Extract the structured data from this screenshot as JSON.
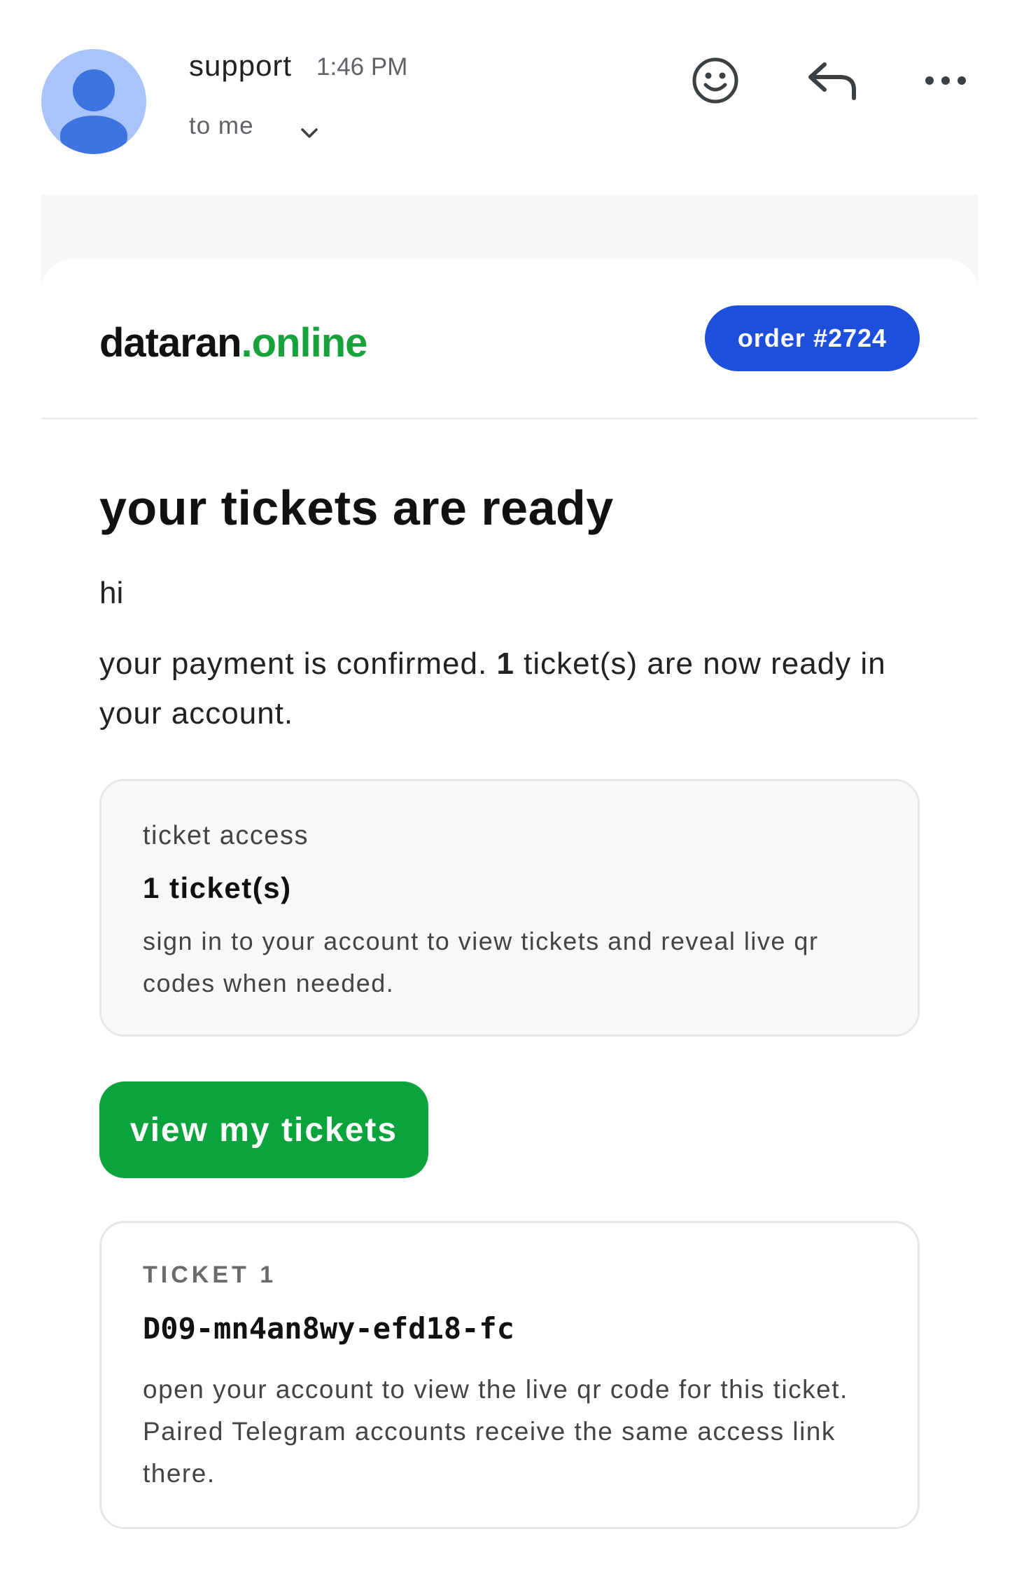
{
  "email_header": {
    "sender": "support",
    "time": "1:46 PM",
    "recipient": "to me",
    "icons": [
      "avatar-icon",
      "chevron-down-icon",
      "emoji-icon",
      "reply-icon",
      "more-icon"
    ]
  },
  "email_body": {
    "brand": {
      "name_main": "dataran",
      "name_accent": ".online",
      "accent_color": "#17a23c"
    },
    "order_badge": {
      "label": "order #2724",
      "color": "#1d4fdb"
    },
    "headline": "your tickets are ready",
    "greeting": "hi",
    "message": {
      "before": "your payment is confirmed. ",
      "count": "1",
      "after": " ticket(s) are now ready in your account."
    },
    "ticket_access": {
      "label": "ticket access",
      "count": "1 ticket(s)",
      "description": "sign in to your account to view tickets and reveal live qr codes when needed."
    },
    "view_button": {
      "label": "view my tickets",
      "color": "#0aa33c"
    },
    "ticket": {
      "label": "TICKET 1",
      "code": "D09-mn4an8wy-efd18-fc",
      "description": "open your account to view the live qr code for this ticket. Paired Telegram accounts receive the same access link there."
    }
  }
}
